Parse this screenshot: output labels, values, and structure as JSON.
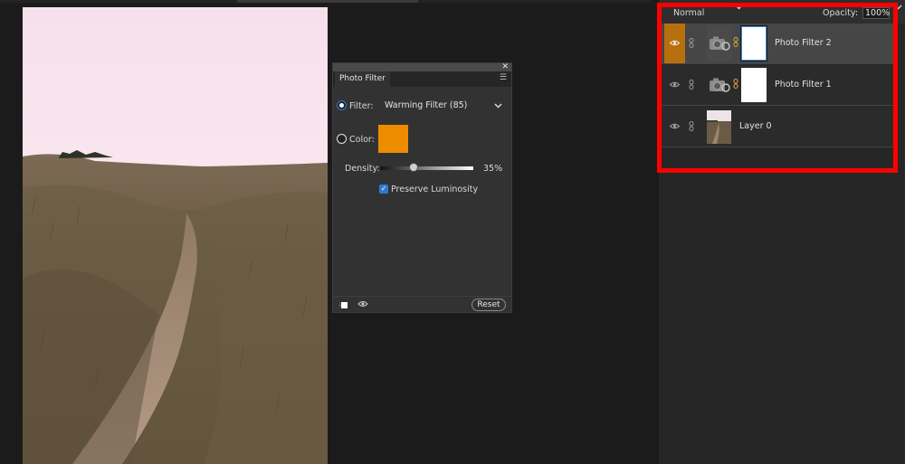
{
  "photo_filter_panel": {
    "title": "Photo Filter",
    "close_glyph": "✕",
    "menu_glyph": "☰",
    "filter_label": "Filter:",
    "filter_value": "Warming Filter (85)",
    "color_label": "Color:",
    "color_swatch": "#ee8c00",
    "density_label": "Density:",
    "density_value": "35%",
    "density_level": 0.35,
    "preserve_luminosity_label": "Preserve Luminosity",
    "preserve_luminosity_checked": true,
    "reset_label": "Reset",
    "icons": [
      "clip-to-layer-icon",
      "visibility-icon"
    ]
  },
  "layers_panel": {
    "blend_mode": "Normal",
    "opacity_label": "Opacity:",
    "opacity_value": "100%",
    "layers": [
      {
        "name": "Photo Filter 2",
        "type": "adjustment",
        "selected": true
      },
      {
        "name": "Photo Filter 1",
        "type": "adjustment",
        "selected": false
      },
      {
        "name": "Layer 0",
        "type": "image",
        "selected": false
      }
    ]
  },
  "colors": {
    "accent_orange": "#b86f0e",
    "selection_blue": "#2d7ad6",
    "highlight_red": "#ff0000"
  }
}
